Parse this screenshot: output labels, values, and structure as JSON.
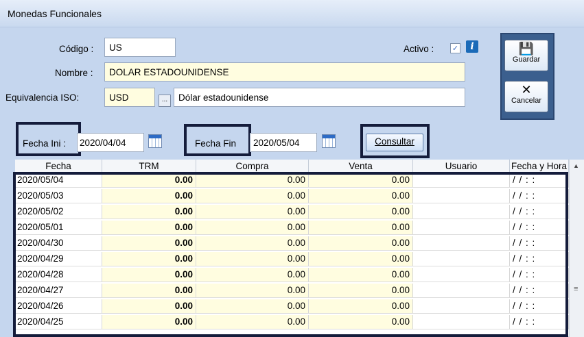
{
  "window": {
    "title": "Monedas Funcionales"
  },
  "form": {
    "codigo_label": "Código :",
    "codigo_value": "US",
    "activo_label": "Activo :",
    "activo_checked": true,
    "nombre_label": "Nombre :",
    "nombre_value": "DOLAR ESTADOUNIDENSE",
    "iso_label": "Equivalencia ISO:",
    "iso_value": "USD",
    "iso_button": "...",
    "iso_desc": "Dólar estadounidense"
  },
  "side": {
    "guardar_label": "Guardar",
    "cancelar_label": "Cancelar"
  },
  "filter": {
    "fecha_ini_label": "Fecha Ini :",
    "fecha_ini_value": "2020/04/04",
    "fecha_fin_label": "Fecha Fin",
    "fecha_fin_value": "2020/05/04",
    "consultar_label": "Consultar"
  },
  "grid": {
    "columns": [
      "Fecha",
      "TRM",
      "Compra",
      "Venta",
      "Usuario",
      "Fecha y Hora"
    ],
    "rows": [
      {
        "fecha": "2020/05/04",
        "trm": "0.00",
        "compra": "0.00",
        "venta": "0.00",
        "usuario": "",
        "fh": "/ /   : :"
      },
      {
        "fecha": "2020/05/03",
        "trm": "0.00",
        "compra": "0.00",
        "venta": "0.00",
        "usuario": "",
        "fh": "/ /   : :"
      },
      {
        "fecha": "2020/05/02",
        "trm": "0.00",
        "compra": "0.00",
        "venta": "0.00",
        "usuario": "",
        "fh": "/ /   : :"
      },
      {
        "fecha": "2020/05/01",
        "trm": "0.00",
        "compra": "0.00",
        "venta": "0.00",
        "usuario": "",
        "fh": "/ /   : :"
      },
      {
        "fecha": "2020/04/30",
        "trm": "0.00",
        "compra": "0.00",
        "venta": "0.00",
        "usuario": "",
        "fh": "/ /   : :"
      },
      {
        "fecha": "2020/04/29",
        "trm": "0.00",
        "compra": "0.00",
        "venta": "0.00",
        "usuario": "",
        "fh": "/ /   : :"
      },
      {
        "fecha": "2020/04/28",
        "trm": "0.00",
        "compra": "0.00",
        "venta": "0.00",
        "usuario": "",
        "fh": "/ /   : :"
      },
      {
        "fecha": "2020/04/27",
        "trm": "0.00",
        "compra": "0.00",
        "venta": "0.00",
        "usuario": "",
        "fh": "/ /   : :"
      },
      {
        "fecha": "2020/04/26",
        "trm": "0.00",
        "compra": "0.00",
        "venta": "0.00",
        "usuario": "",
        "fh": "/ /   : :"
      },
      {
        "fecha": "2020/04/25",
        "trm": "0.00",
        "compra": "0.00",
        "venta": "0.00",
        "usuario": "",
        "fh": "/ /   : :"
      }
    ]
  },
  "colors": {
    "highlight_border": "#141c3b",
    "editable_cell": "#fffde0",
    "panel": "#c5d6ee"
  }
}
